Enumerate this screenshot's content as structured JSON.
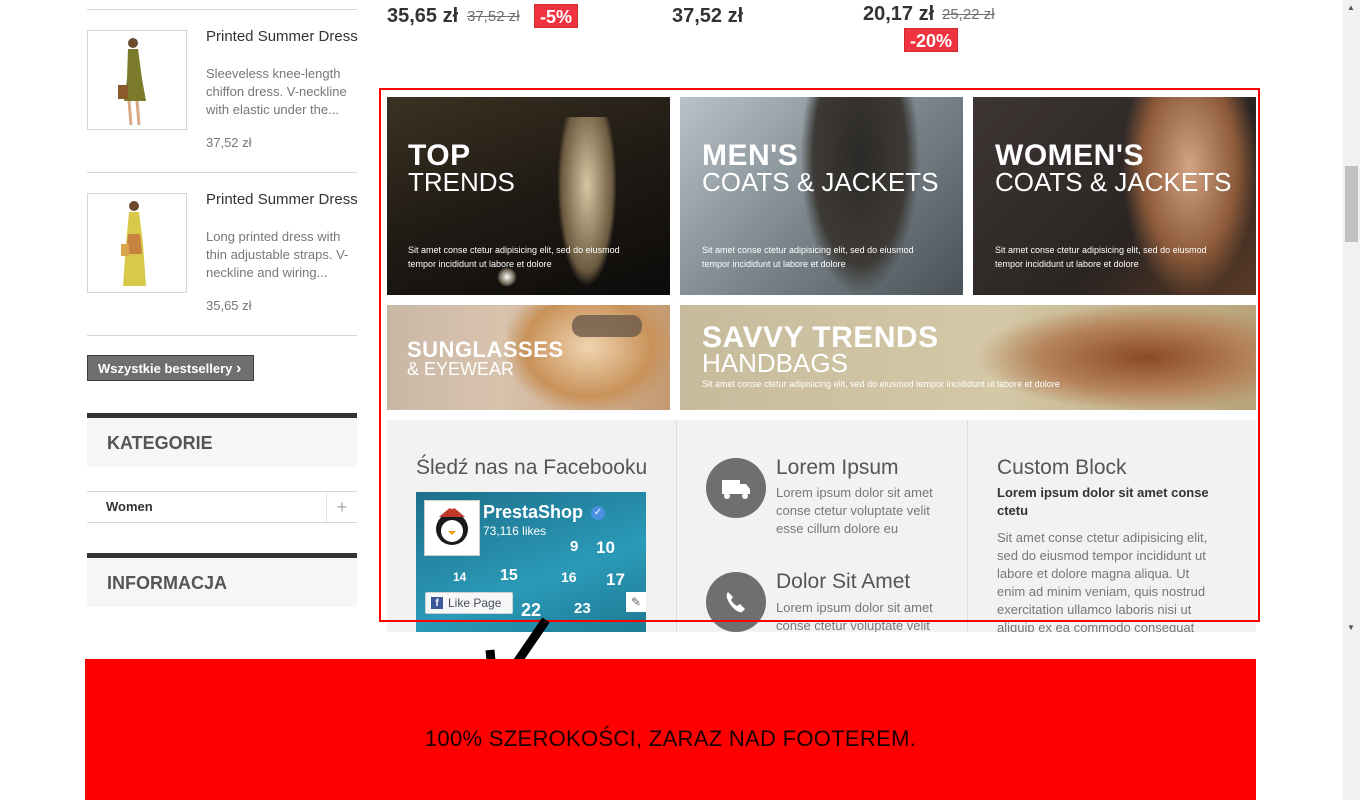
{
  "products": [
    {
      "name": "Printed Summer Dress",
      "desc": "Sleeveless knee-length chiffon dress. V-neckline with elastic under the...",
      "price": "37,52 zł"
    },
    {
      "name": "Printed Summer Dress",
      "desc": "Long printed dress with thin adjustable straps. V-neckline and wiring...",
      "price": "35,65 zł"
    }
  ],
  "bestsellers_button": "Wszystkie bestsellery",
  "bestsellers_chevron": "›",
  "categories": {
    "title": "KATEGORIE",
    "item": "Women",
    "expand": "+"
  },
  "information": {
    "title": "INFORMACJA"
  },
  "top_prices": [
    {
      "price": "35,65 zł",
      "old": "37,52 zł",
      "discount": "-5%"
    },
    {
      "price": "37,52 zł"
    },
    {
      "price": "20,17 zł",
      "old": "25,22 zł",
      "discount": "-20%"
    }
  ],
  "banners": [
    {
      "title1": "TOP",
      "title2": "TRENDS",
      "text": "Sit amet conse ctetur adipisicing elit, sed do eiusmod tempor incididunt ut labore et dolore"
    },
    {
      "title1": "MEN'S",
      "title2": "COATS & JACKETS",
      "text": "Sit amet conse ctetur adipisicing elit, sed do eiusmod tempor incididunt ut labore et dolore"
    },
    {
      "title1": "WOMEN'S",
      "title2": "COATS & JACKETS",
      "text": "Sit amet conse ctetur adipisicing elit, sed do eiusmod tempor incididunt ut labore et dolore"
    },
    {
      "title1": "SUNGLASSES",
      "title2": "& EYEWEAR"
    },
    {
      "title1": "SAVVY TRENDS",
      "title2": "HANDBAGS",
      "text": "Sit amet conse ctetur adipisicing elit, sed do eiusmod tempor incididunt ut labore et dolore"
    }
  ],
  "facebook": {
    "heading": "Śledź nas na Facebooku",
    "page_name": "PrestaShop",
    "likes": "73,116 likes",
    "like_button": "Like Page",
    "calendar": [
      "9",
      "10",
      "14",
      "15",
      "16",
      "17",
      "22",
      "23"
    ]
  },
  "info_blocks": [
    {
      "title": "Lorem Ipsum",
      "text": "Lorem ipsum dolor sit amet conse ctetur voluptate velit esse cillum dolore eu"
    },
    {
      "title": "Dolor Sit Amet",
      "text": "Lorem ipsum dolor sit amet conse ctetur voluptate velit"
    }
  ],
  "custom_block": {
    "title": "Custom Block",
    "subtitle": "Lorem ipsum dolor sit amet conse ctetu",
    "text": "Sit amet conse ctetur adipisicing elit, sed do eiusmod tempor incididunt ut labore et dolore magna aliqua. Ut enim ad minim veniam, quis nostrud exercitation ullamco laboris nisi ut aliquip ex ea commodo consequat"
  },
  "annotation": "100% SZEROKOŚCI, ZARAZ NAD FOOTEREM.",
  "colors": {
    "highlight": "#ff0000",
    "discount": "#f13340",
    "dark": "#333333"
  }
}
